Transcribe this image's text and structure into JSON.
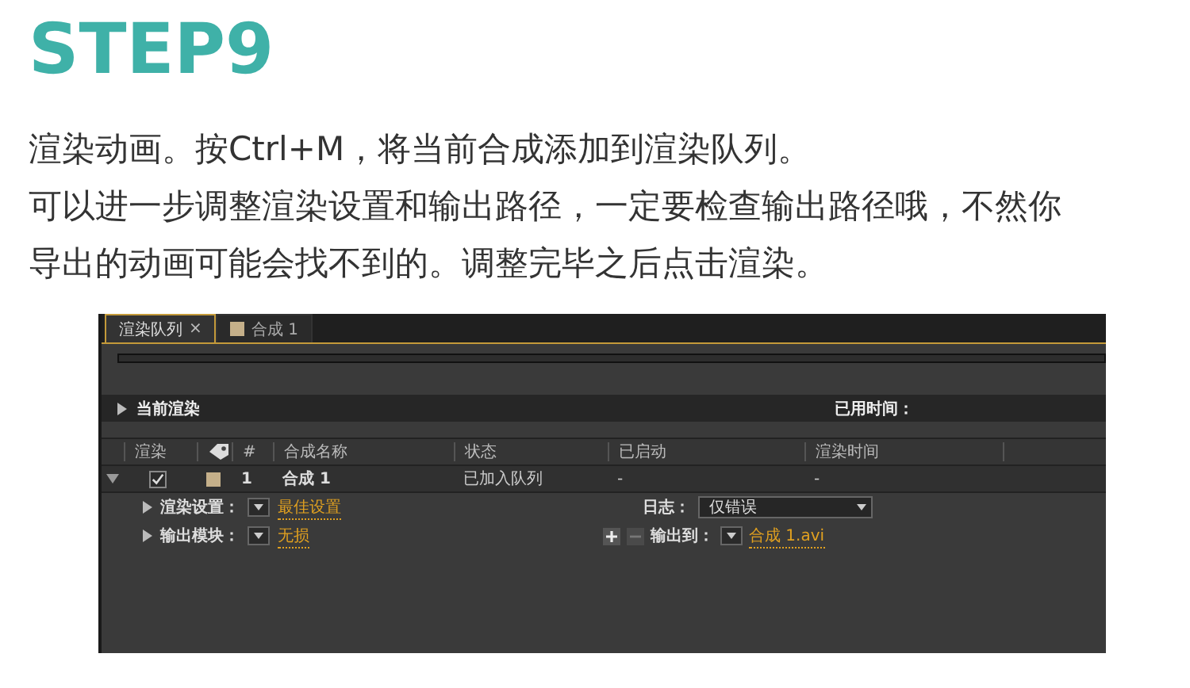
{
  "heading": "STEP9",
  "lines": [
    "渲染动画。按Ctrl+M，将当前合成添加到渲染队列。",
    "可以进一步调整渲染设置和输出路径，一定要检查输出路径哦，不然你",
    "导出的动画可能会找不到的。调整完毕之后点击渲染。"
  ],
  "panel": {
    "tabs": [
      {
        "label": "渲染队列",
        "selected": true,
        "close": "×"
      },
      {
        "label": "合成 1",
        "selected": false
      }
    ],
    "current_render": {
      "label": "当前渲染",
      "expanded": false,
      "elapsed_label": "已用时间："
    },
    "columns": [
      "渲染",
      "#",
      "合成名称",
      "状态",
      "已启动",
      "渲染时间"
    ],
    "items": [
      {
        "expanded": true,
        "render": true,
        "number": "1",
        "name": "合成 1",
        "status": "已加入队列",
        "started": "-",
        "render_time": "-",
        "render_settings": {
          "label": "渲染设置：",
          "value": "最佳设置",
          "expanded": false
        },
        "log": {
          "label": "日志：",
          "value": "仅错误"
        },
        "output_module": {
          "label": "输出模块：",
          "value": "无损",
          "expanded": false
        },
        "output_to": {
          "label": "输出到：",
          "value": "合成 1.avi"
        }
      }
    ]
  }
}
